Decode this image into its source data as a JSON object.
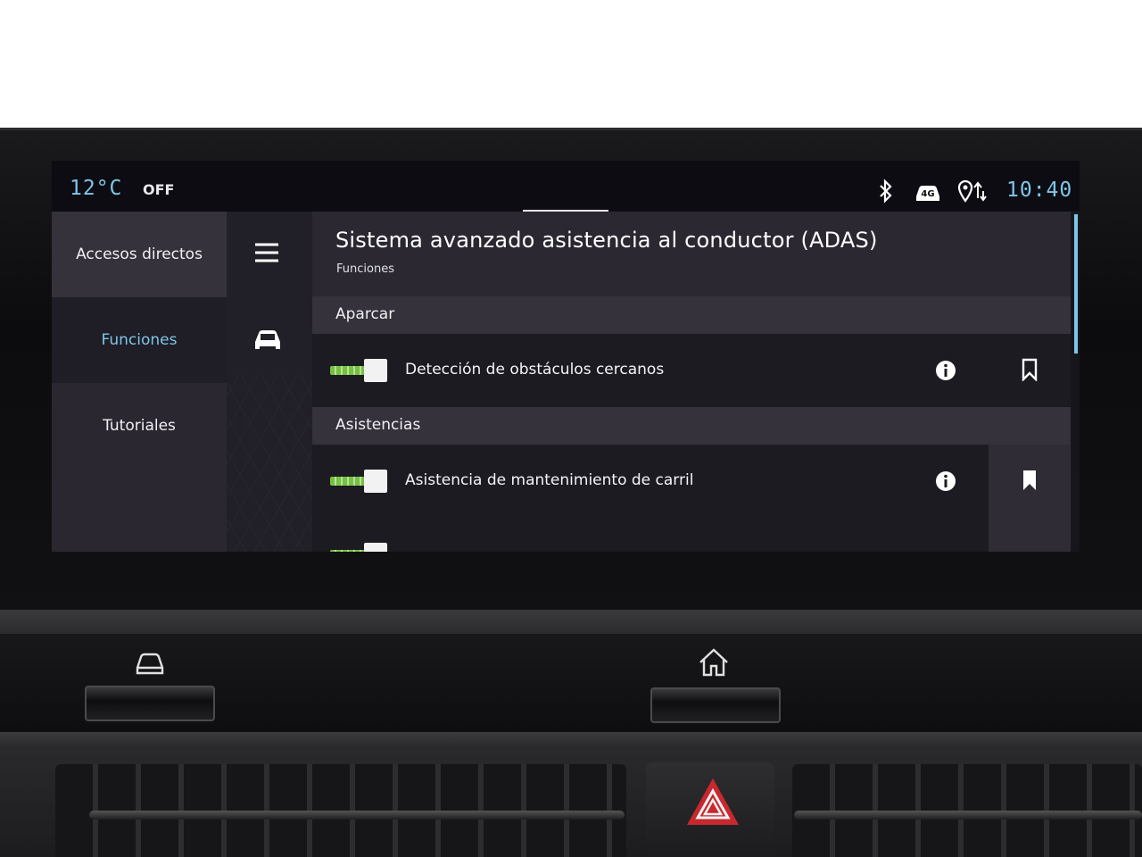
{
  "status": {
    "temperature": "12°C",
    "ac_state": "OFF",
    "time": "10:40",
    "network": "4G",
    "icons": [
      "bluetooth-icon",
      "car-connect-icon",
      "location-sync-icon"
    ],
    "accent_color": "#7fc6e8"
  },
  "menu": {
    "items": [
      {
        "label": "Accesos directos"
      },
      {
        "label": "Funciones",
        "selected": true
      },
      {
        "label": "Tutoriales"
      }
    ]
  },
  "rail": {
    "icons": [
      "hamburger-menu-icon",
      "car-icon"
    ]
  },
  "page": {
    "title": "Sistema avanzado asistencia al conductor (ADAS)",
    "subtitle": "Funciones"
  },
  "sections": [
    {
      "label": "Aparcar",
      "rows": [
        {
          "label": "Detección de obstáculos cercanos",
          "enabled": true,
          "bookmarked": false
        }
      ]
    },
    {
      "label": "Asistencias",
      "rows": [
        {
          "label": "Asistencia de mantenimiento de carril",
          "enabled": true,
          "bookmarked": true
        }
      ]
    }
  ],
  "hardware": {
    "keys": [
      "car-key-icon",
      "home-key-icon"
    ],
    "hazard_color": "#c8282e"
  }
}
